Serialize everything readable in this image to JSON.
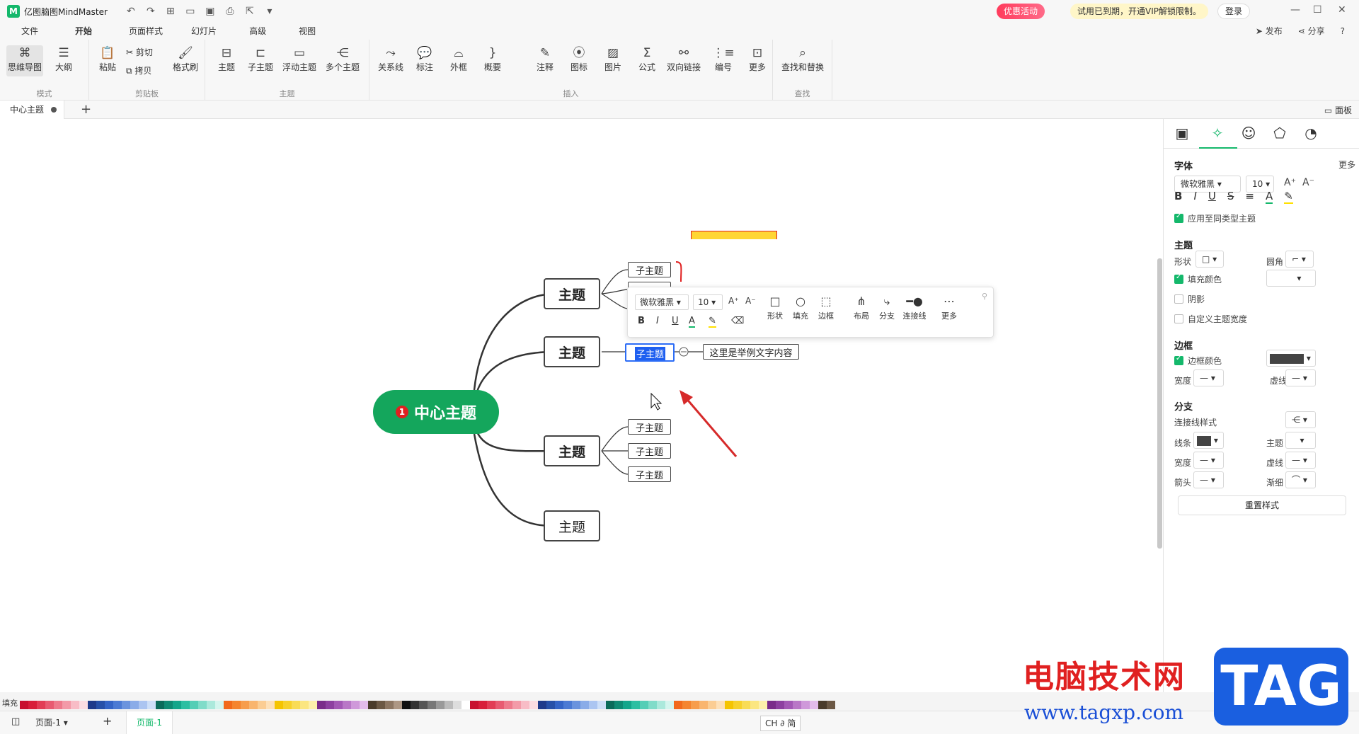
{
  "app": {
    "title": "亿图脑图MindMaster",
    "logo_letter": "M"
  },
  "titlebar": {
    "promo": "优惠活动",
    "vip": "试用已到期，开通VIP解锁限制。",
    "login": "登录"
  },
  "menu": {
    "items": [
      "文件",
      "开始",
      "页面样式",
      "幻灯片",
      "高级",
      "视图"
    ],
    "active": "开始",
    "right": [
      "发布",
      "分享",
      "?"
    ]
  },
  "ribbon": {
    "groups": {
      "mode": "模式",
      "clipboard": "剪贴板",
      "topic": "主题",
      "insert": "插入",
      "find": "查找"
    },
    "buttons": {
      "mindmap": "思维导图",
      "outline": "大纲",
      "paste": "粘贴",
      "cut": "剪切",
      "copy": "拷贝",
      "format_painter": "格式刷",
      "topic": "主题",
      "subtopic": "子主题",
      "float_topic": "浮动主题",
      "multi_topic": "多个主题",
      "relation": "关系线",
      "callout": "标注",
      "boundary": "外框",
      "summary": "概要",
      "note": "注释",
      "icon": "图标",
      "image": "图片",
      "formula": "公式",
      "link": "双向链接",
      "numbering": "编号",
      "more": "更多",
      "find_replace": "查找和替换"
    }
  },
  "tabs": {
    "doc": "中心主题",
    "panel_toggle": "面板"
  },
  "mindmap": {
    "center": "中心主题",
    "center_badge": "1",
    "topics": [
      "主题",
      "主题",
      "主题",
      "主题"
    ],
    "subtopics_1": [
      "子主题",
      "子主题"
    ],
    "selected_subtopic": "子主题",
    "note_text": "这里是举例文字内容",
    "subtopics_3": [
      "子主题",
      "子主题",
      "子主题"
    ]
  },
  "float_toolbar": {
    "font": "微软雅黑",
    "size": "10",
    "buttons": [
      "形状",
      "填充",
      "边框",
      "布局",
      "分支",
      "连接线",
      "更多"
    ]
  },
  "panel": {
    "font_section": "字体",
    "more": "更多",
    "font_name": "微软雅黑",
    "font_size": "10",
    "apply_same": "应用至同类型主题",
    "topic_section": "主题",
    "shape": "形状",
    "corner": "圆角",
    "fill_color": "填充颜色",
    "shadow": "阴影",
    "custom_width": "自定义主题宽度",
    "border_section": "边框",
    "border_color": "边框颜色",
    "width": "宽度",
    "dash": "虚线",
    "branch_section": "分支",
    "line_style": "连接线样式",
    "line": "线条",
    "topic": "主题",
    "width2": "宽度",
    "dash2": "虚线",
    "arrow": "箭头",
    "taper": "渐细",
    "reset": "重置样式",
    "border_swatch": "#444444",
    "line_swatch": "#444444"
  },
  "palette": {
    "label": "填充"
  },
  "status": {
    "page_select": "页面-1",
    "page_tab": "页面-1",
    "ime": "CH ∂ 简"
  },
  "watermark": {
    "cn": "电脑技术网",
    "url": "www.tagxp.com",
    "logo": "TAG"
  },
  "colors": {
    "accent": "#14b86b",
    "center_fill": "#14a65c",
    "promo": "#ff3b5c",
    "arrow": "#d62a2a"
  }
}
